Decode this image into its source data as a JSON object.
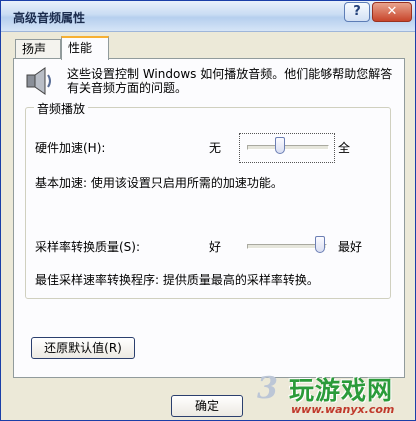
{
  "window": {
    "title": "高级音频属性",
    "help_glyph": "?",
    "close_glyph": "✕"
  },
  "tabs": [
    {
      "label": "扬声器",
      "active": false
    },
    {
      "label": "性能",
      "active": true
    }
  ],
  "description": "这些设置控制 Windows 如何播放音频。他们能够帮助您解答有关音频方面的问题。",
  "playback": {
    "group_title": "音频播放",
    "hw_accel": {
      "label": "硬件加速(H):",
      "min_label": "无",
      "max_label": "全",
      "value_fraction": 0.4,
      "status": "基本加速: 使用该设置只启用所需的加速功能。"
    },
    "sample_rate": {
      "label": "采样率转换质量(S):",
      "min_label": "好",
      "max_label": "最好",
      "value_fraction": 1.0,
      "status": "最佳采样速率转换程序: 提供质量最高的采样率转换。"
    }
  },
  "restore_button": "还原默认值(R)",
  "ok_button_partial": "确定",
  "watermark": {
    "number": "3",
    "text": "玩游戏网",
    "url": "www.wanyx.com"
  },
  "colors": {
    "title_blue": "#1b2c4e",
    "tab_highlight": "#f7b033",
    "watermark_green": "#2b9b3a",
    "watermark_red": "#c0392b"
  }
}
